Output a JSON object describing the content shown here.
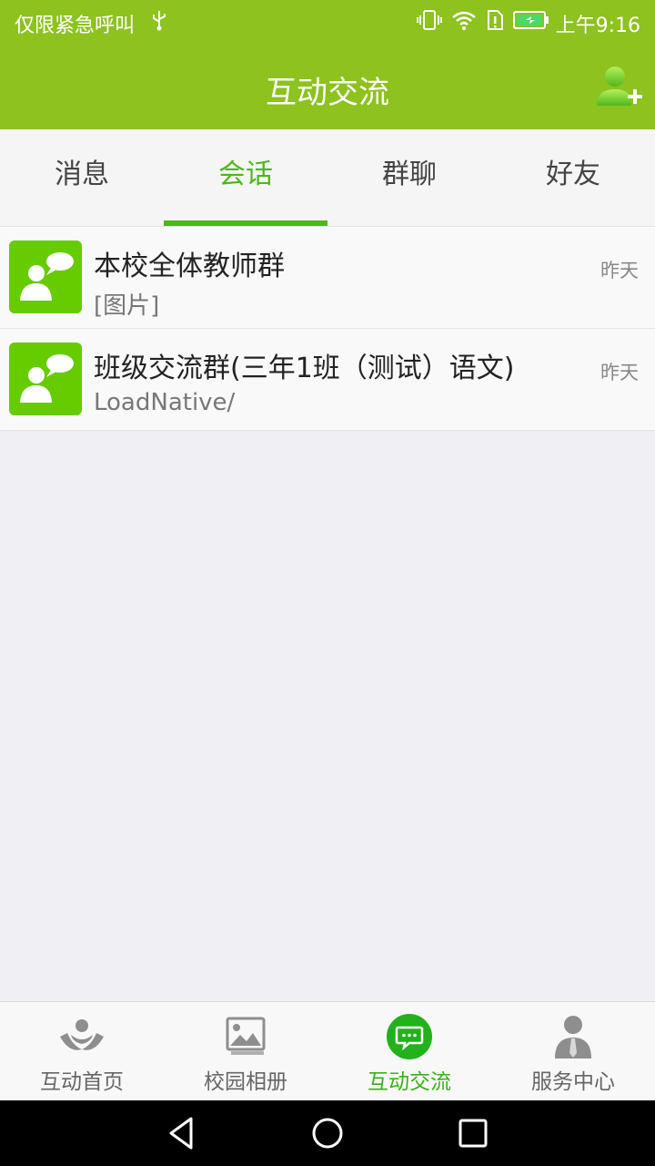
{
  "status_bar": {
    "carrier": "仅限紧急呼叫",
    "time": "上午9:16",
    "icons": [
      "usb-icon",
      "vibrate-icon",
      "wifi-icon",
      "sim-icon",
      "battery-charging-icon"
    ]
  },
  "header": {
    "title": "互动交流",
    "action_icon": "add-friend-icon"
  },
  "tabs": [
    {
      "label": "消息",
      "active": false
    },
    {
      "label": "会话",
      "active": true
    },
    {
      "label": "群聊",
      "active": false
    },
    {
      "label": "好友",
      "active": false
    }
  ],
  "conversations": [
    {
      "name": "本校全体教师群",
      "preview": "[图片]",
      "time": "昨天",
      "icon": "group-chat-icon"
    },
    {
      "name": "班级交流群(三年1班（测试）语文)",
      "preview": "LoadNative/",
      "time": "昨天",
      "icon": "group-chat-icon"
    }
  ],
  "bottom_nav": [
    {
      "label": "互动首页",
      "icon": "home-hands-icon",
      "active": false
    },
    {
      "label": "校园相册",
      "icon": "photo-album-icon",
      "active": false
    },
    {
      "label": "互动交流",
      "icon": "chat-bubble-icon",
      "active": true
    },
    {
      "label": "服务中心",
      "icon": "person-service-icon",
      "active": false
    }
  ],
  "colors": {
    "brand_green": "#8dc21f",
    "active_green": "#4db818",
    "avatar_green": "#66cc00",
    "background": "#efeff4"
  }
}
